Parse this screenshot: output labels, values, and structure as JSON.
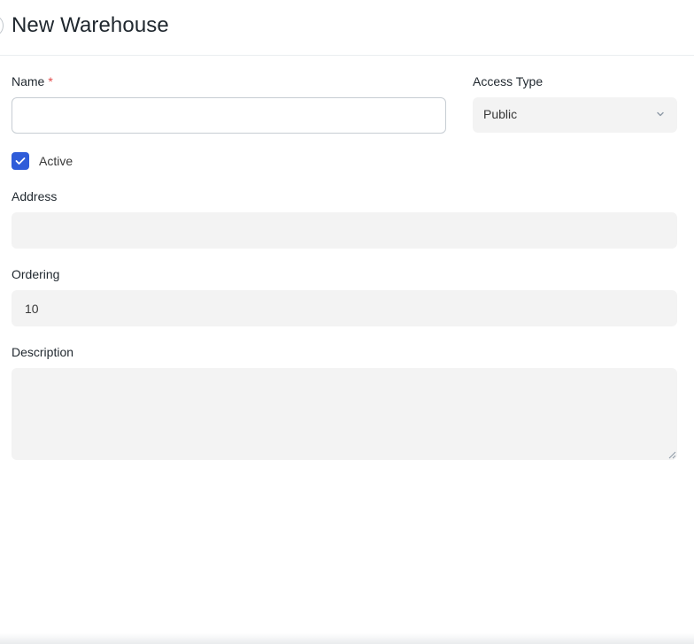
{
  "header": {
    "title": "New Warehouse"
  },
  "form": {
    "name": {
      "label": "Name",
      "required_mark": "*",
      "value": ""
    },
    "access_type": {
      "label": "Access Type",
      "value": "Public"
    },
    "active": {
      "label": "Active",
      "checked": true
    },
    "address": {
      "label": "Address",
      "value": ""
    },
    "ordering": {
      "label": "Ordering",
      "value": "10"
    },
    "description": {
      "label": "Description",
      "value": ""
    }
  },
  "colors": {
    "accent": "#2f5cd9",
    "required": "#e24c4c",
    "field_bg": "#f3f3f3"
  },
  "icons": {
    "select_chevron": "chevron-down-icon",
    "checkbox_mark": "check-icon"
  }
}
